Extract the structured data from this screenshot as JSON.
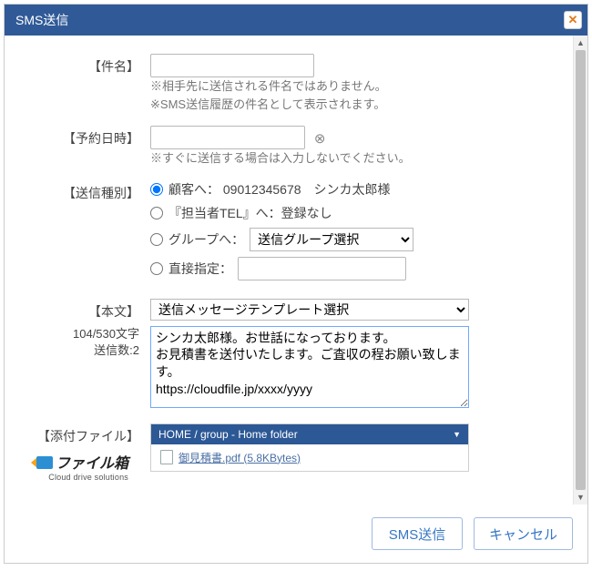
{
  "title": "SMS送信",
  "labels": {
    "subject": "【件名】",
    "schedule": "【予約日時】",
    "send_type": "【送信種別】",
    "body": "【本文】",
    "attachment": "【添付ファイル】"
  },
  "subject": {
    "value": "",
    "hint1": "※相手先に送信される件名ではありません。",
    "hint2": "※SMS送信履歴の件名として表示されます。"
  },
  "schedule": {
    "value": "",
    "hint": "※すぐに送信する場合は入力しないでください。"
  },
  "send_type": {
    "options": {
      "customer": "顧客へ： 09012345678　シンカ太郎様",
      "contact": "『担当者TEL』へ：登録なし",
      "group": "グループへ：",
      "direct": "直接指定："
    },
    "group_select_label": "送信グループ選択",
    "direct_value": "",
    "selected": "customer"
  },
  "body": {
    "counter": "104/530文字",
    "send_count": "送信数:2",
    "template_label": "送信メッセージテンプレート選択",
    "text": "シンカ太郎様。お世話になっております。\nお見積書を送付いたします。ご査収の程お願い致します。\nhttps://cloudfile.jp/xxxx/yyyy"
  },
  "attachment": {
    "breadcrumb": "HOME / group - Home folder",
    "file_name": "御見積書.pdf (5.8KBytes)"
  },
  "filebox_logo": {
    "name": "ファイル箱",
    "tagline": "Cloud drive solutions"
  },
  "buttons": {
    "submit": "SMS送信",
    "cancel": "キャンセル"
  }
}
